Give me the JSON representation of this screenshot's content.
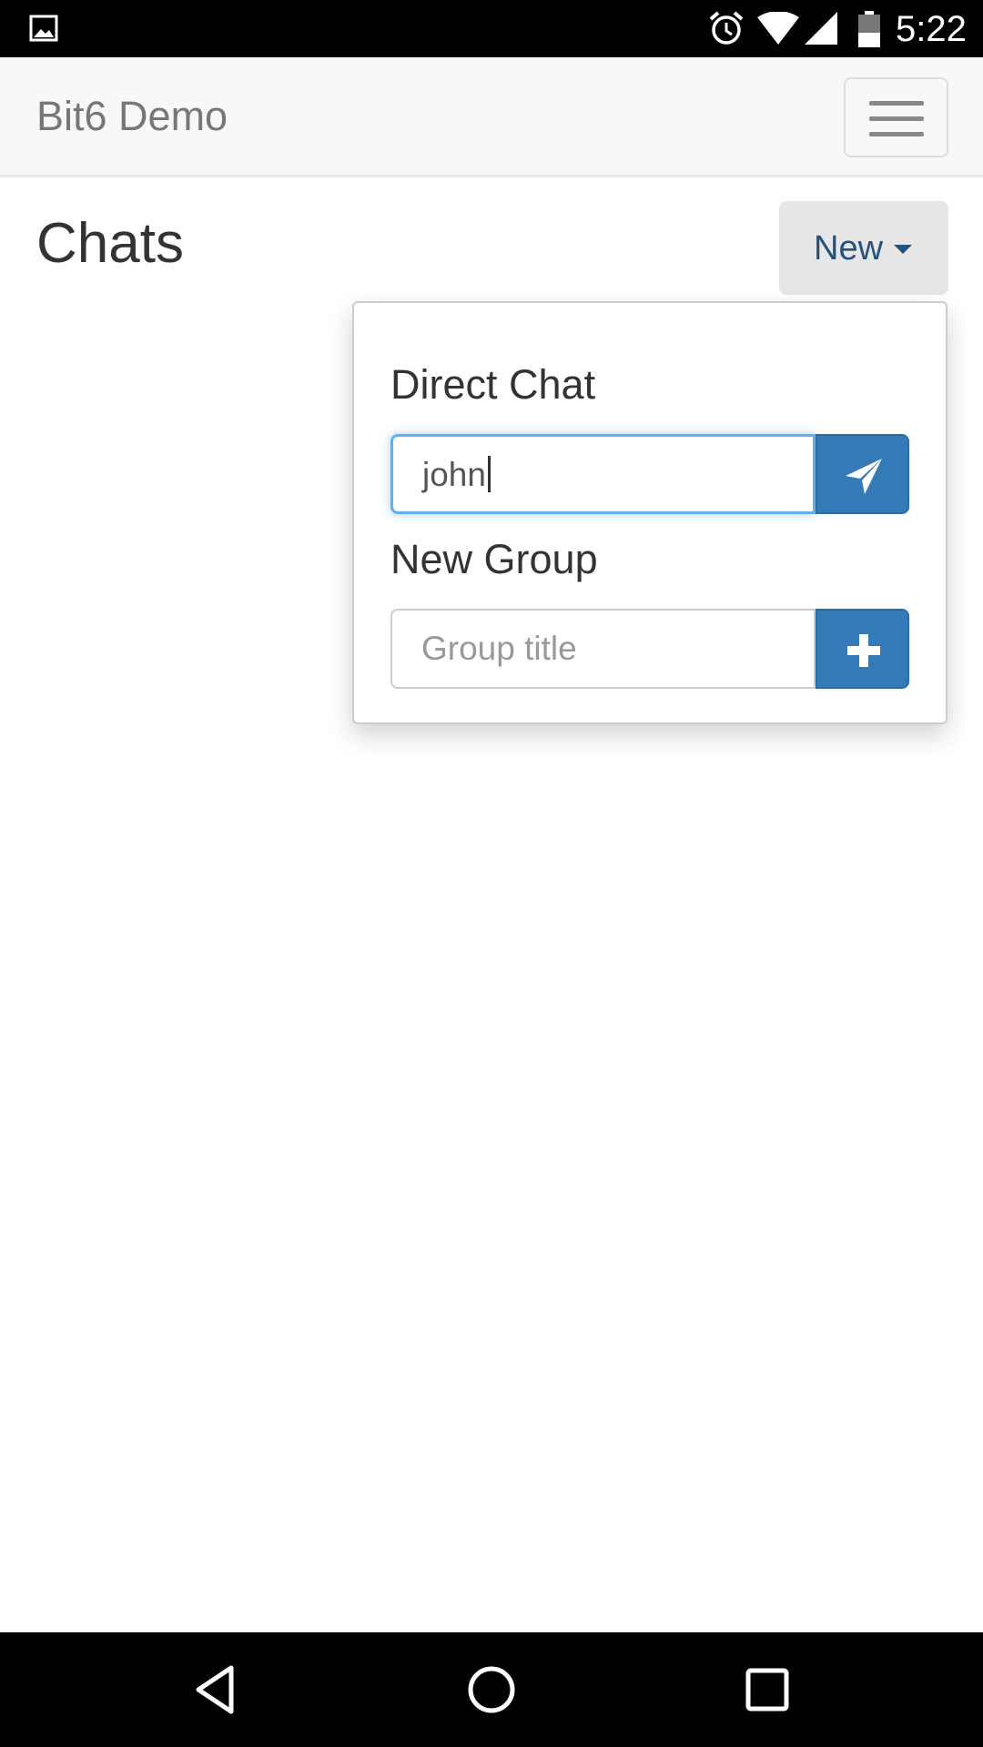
{
  "status_bar": {
    "time": "5:22",
    "icons": [
      "gallery-icon",
      "alarm-icon",
      "wifi-icon",
      "signal-icon",
      "battery-icon"
    ]
  },
  "navbar": {
    "brand": "Bit6 Demo",
    "menu_icon": "hamburger-menu-icon"
  },
  "page": {
    "title": "Chats",
    "new_button_label": "New"
  },
  "dropdown": {
    "direct_chat": {
      "label": "Direct Chat",
      "input_value": "john",
      "button_icon": "send-icon"
    },
    "new_group": {
      "label": "New Group",
      "input_placeholder": "Group title",
      "button_icon": "plus-icon"
    }
  },
  "system_nav": {
    "icons": [
      "back-icon",
      "home-icon",
      "recents-icon"
    ]
  },
  "colors": {
    "primary": "#337ab7",
    "link": "#23527c",
    "focus": "#66afe9",
    "navbar_bg": "#f8f8f8"
  }
}
